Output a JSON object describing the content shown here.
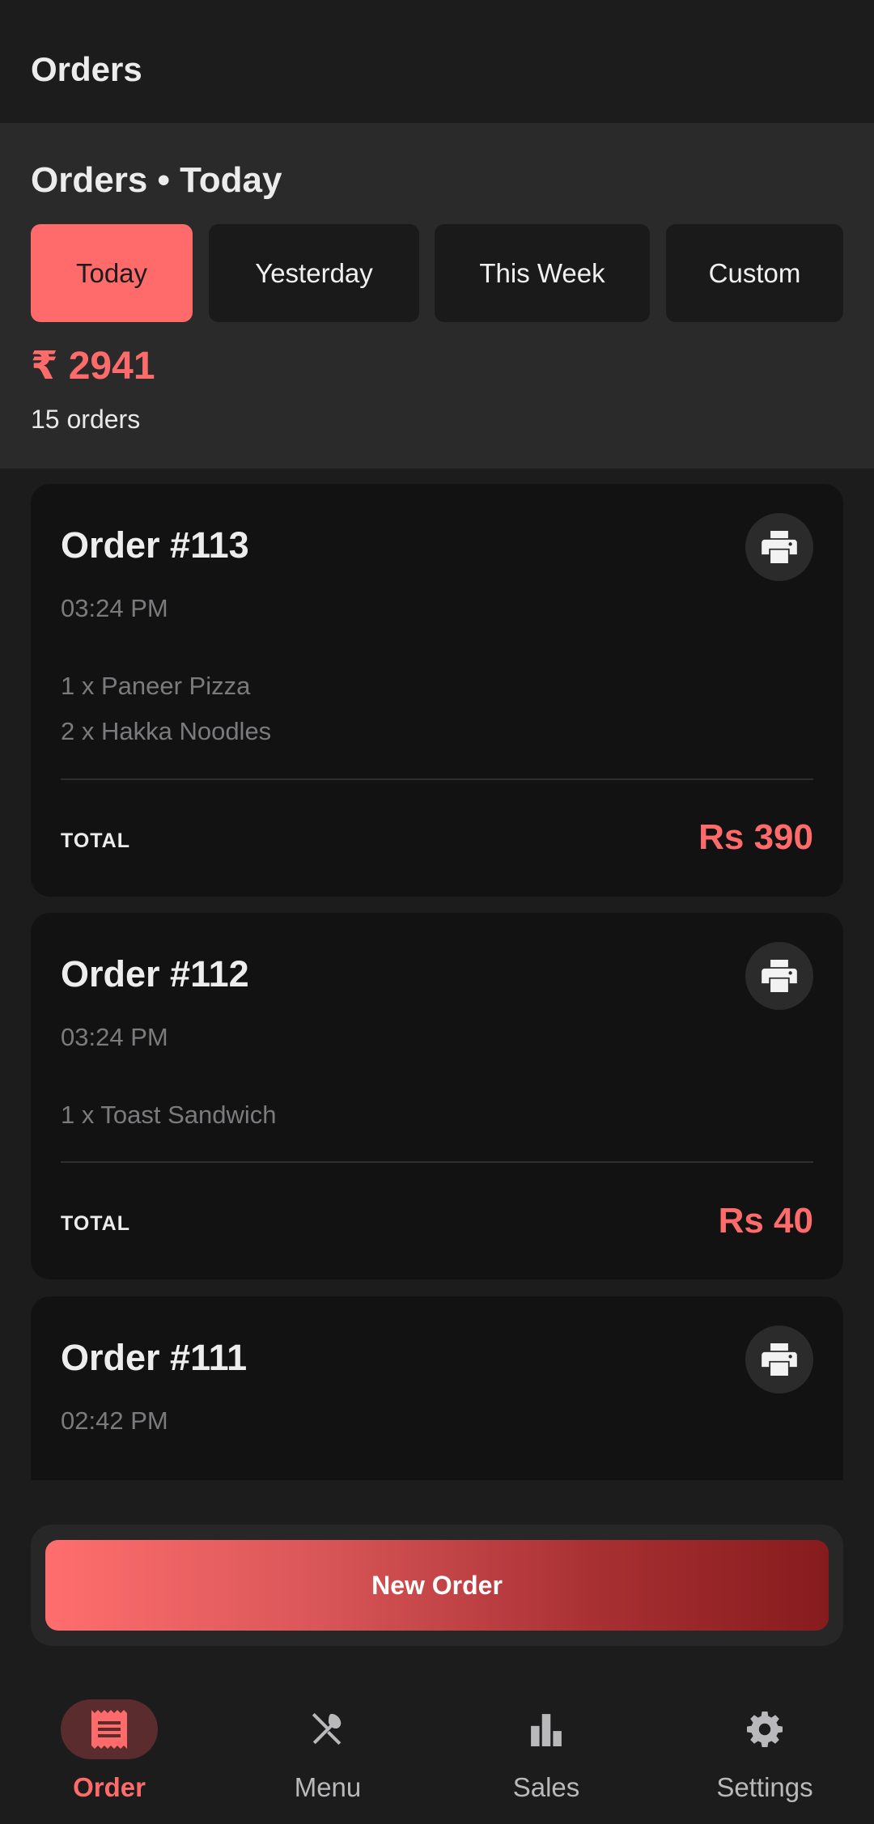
{
  "appbar": {
    "title": "Orders"
  },
  "summary": {
    "heading": "Orders • Today",
    "filters": [
      {
        "label": "Today",
        "active": true
      },
      {
        "label": "Yesterday",
        "active": false
      },
      {
        "label": "This Week",
        "active": false
      },
      {
        "label": "Custom",
        "active": false
      }
    ],
    "total_amount": "₹ 2941",
    "order_count": "15 orders"
  },
  "orders": [
    {
      "title": "Order #113",
      "time": "03:24 PM",
      "items": [
        "1 x Paneer Pizza",
        "2 x Hakka Noodles"
      ],
      "total_label": "TOTAL",
      "total": "Rs 390"
    },
    {
      "title": "Order #112",
      "time": "03:24 PM",
      "items": [
        "1 x Toast Sandwich"
      ],
      "total_label": "TOTAL",
      "total": "Rs 40"
    },
    {
      "title": "Order #111",
      "time": "02:42 PM",
      "items": [],
      "total_label": "",
      "total": ""
    }
  ],
  "actions": {
    "new_order_label": "New Order"
  },
  "bottom_nav": {
    "items": [
      {
        "label": "Order",
        "icon": "receipt-icon",
        "active": true
      },
      {
        "label": "Menu",
        "icon": "utensils-icon",
        "active": false
      },
      {
        "label": "Sales",
        "icon": "bar-chart-icon",
        "active": false
      },
      {
        "label": "Settings",
        "icon": "gear-icon",
        "active": false
      }
    ]
  },
  "colors": {
    "accent": "#ff6b6b",
    "background": "#1c1c1d",
    "card": "#121213",
    "panel": "#2a2a2b"
  }
}
